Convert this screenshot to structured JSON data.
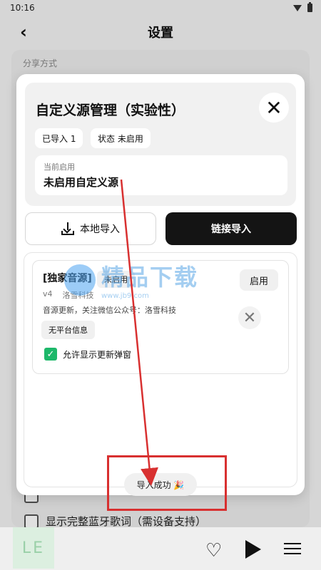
{
  "status_bar": {
    "time": "10:16",
    "wifi_icon": "wifi-icon",
    "battery_icon": "battery-icon"
  },
  "header": {
    "title": "设置",
    "back_icon": "back-chevron-icon"
  },
  "background": {
    "section_label": "分享方式",
    "rows": [
      {
        "label": "显示完整蓝牙歌词（需设备支持）",
        "checked": false
      }
    ]
  },
  "modal": {
    "title": "自定义源管理（实验性）",
    "close_icon": "close-icon",
    "tags": {
      "imported": "已导入 1",
      "status": "状态 未启用"
    },
    "current": {
      "label": "当前启用",
      "value": "未启用自定义源"
    },
    "buttons": {
      "local_import": "本地导入",
      "link_import": "链接导入"
    },
    "source": {
      "name": "[独家音源]",
      "status": "未启用",
      "enable_label": "启用",
      "version": "v4",
      "author": "洛雪科技",
      "description": "音源更新，关注微信公众号：洛雪科技",
      "platform_tag": "无平台信息",
      "allow_popup_label": "允许显示更新弹窗",
      "allow_popup_checked": true
    }
  },
  "toast": {
    "text": "导入成功 🎉"
  },
  "watermark": {
    "text": "精品下载",
    "sub": "www.jb9.com"
  },
  "player": {
    "album_text": "LE",
    "heart_icon": "heart-icon",
    "play_icon": "play-icon",
    "queue_icon": "queue-icon"
  },
  "colors": {
    "accent_dark": "#141414",
    "check_green": "#1db86a",
    "annotation_red": "#d83030"
  }
}
